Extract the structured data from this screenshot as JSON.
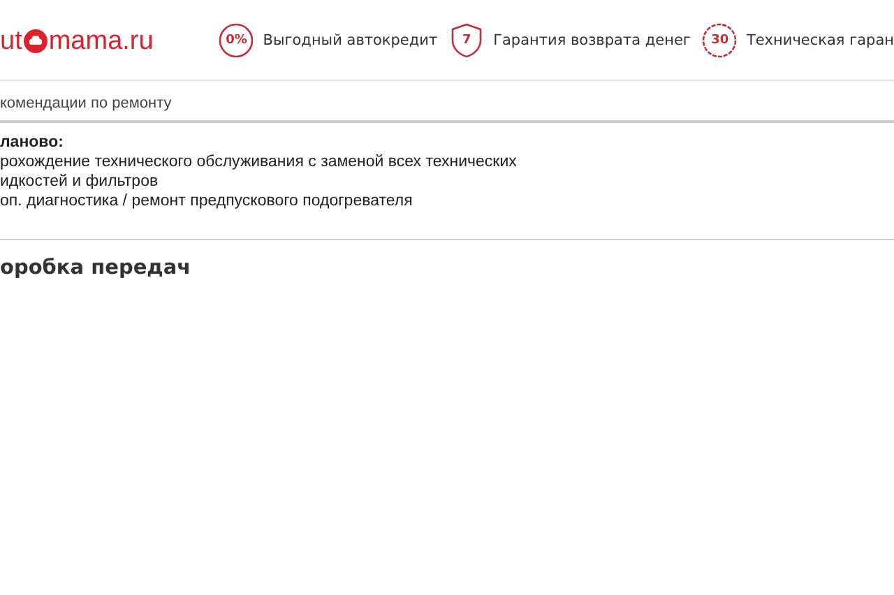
{
  "logo": {
    "before": "ut",
    "after": "mama.ru"
  },
  "features": [
    {
      "kind": "circle",
      "badge": "0%",
      "label": "Выгодный автокредит"
    },
    {
      "kind": "shield",
      "badge": "7",
      "label": "Гарантия возврата денег"
    },
    {
      "kind": "seal",
      "badge": "30",
      "label": "Техническая гаран"
    }
  ],
  "recommendations": {
    "title": "комендации по ремонту",
    "heading": "ланово:",
    "lines": [
      "рохождение технического обслуживания с заменой всех технических",
      "идкостей и фильтров",
      "оп. диагностика / ремонт предпускового подогревателя"
    ]
  },
  "section": {
    "title": "оробка передач"
  }
}
